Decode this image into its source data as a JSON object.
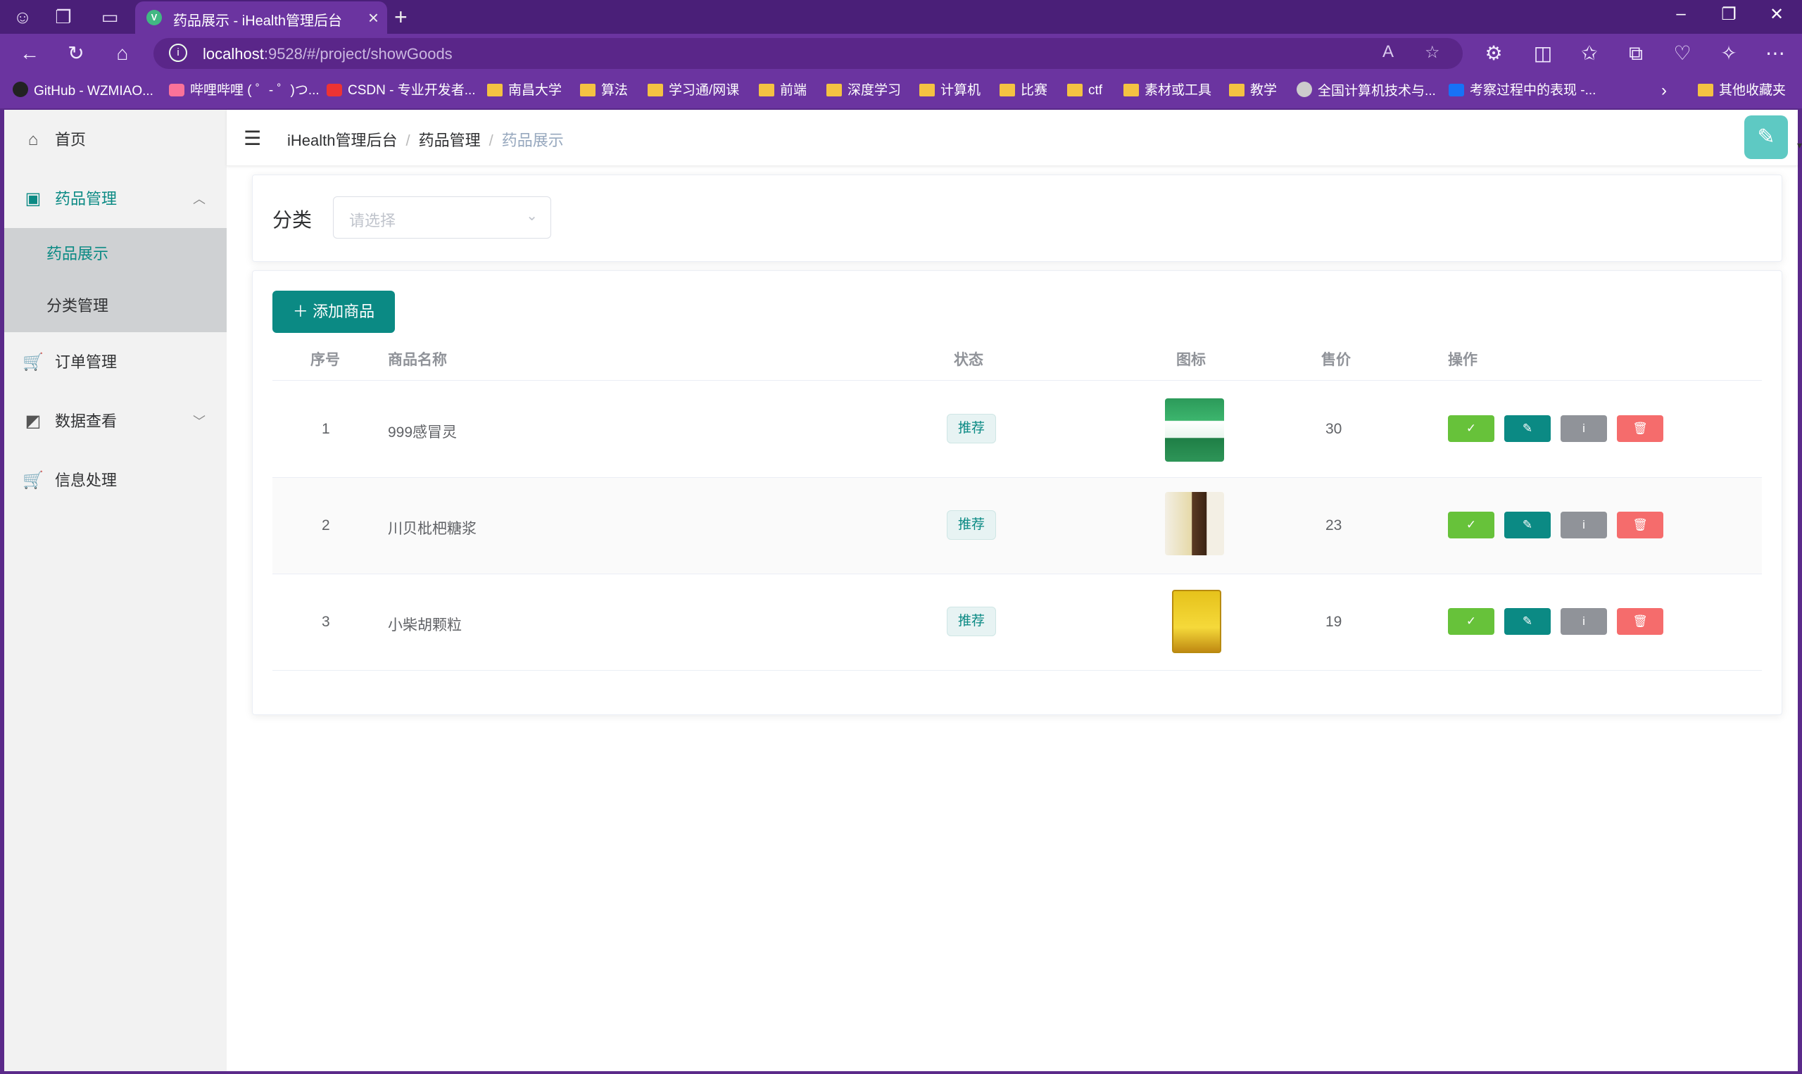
{
  "browser": {
    "tab_title": "药品展示 - iHealth管理后台",
    "url_host": "localhost",
    "url_rest": ":9528/#/project/showGoods",
    "bookmarks": [
      "GitHub - WZMIAO...",
      "哔哩哔哩 ( ゜- ゜)つ...",
      "CSDN - 专业开发者...",
      "南昌大学",
      "算法",
      "学习通/网课",
      "前端",
      "深度学习",
      "计算机",
      "比赛",
      "ctf",
      "素材或工具",
      "教学",
      "全国计算机技术与...",
      "考察过程中的表现 -...",
      "其他收藏夹"
    ]
  },
  "sidebar": {
    "items": [
      {
        "label": "首页",
        "icon": "home-icon"
      },
      {
        "label": "药品管理",
        "icon": "bag-icon"
      },
      {
        "label": "订单管理",
        "icon": "cart-icon"
      },
      {
        "label": "数据查看",
        "icon": "chart-icon"
      },
      {
        "label": "信息处理",
        "icon": "cart-icon"
      }
    ],
    "subitems": [
      {
        "label": "药品展示"
      },
      {
        "label": "分类管理"
      }
    ]
  },
  "header": {
    "breadcrumb": [
      "iHealth管理后台",
      "药品管理",
      "药品展示"
    ]
  },
  "filter": {
    "label": "分类",
    "placeholder": "请选择"
  },
  "toolbar": {
    "add_label": "添加商品"
  },
  "table": {
    "headers": [
      "序号",
      "商品名称",
      "状态",
      "图标",
      "售价",
      "操作"
    ],
    "rows": [
      {
        "index": "1",
        "name": "999感冒灵",
        "status": "推荐",
        "price": "30"
      },
      {
        "index": "2",
        "name": "川贝枇杷糖浆",
        "status": "推荐",
        "price": "23"
      },
      {
        "index": "3",
        "name": "小柴胡颗粒",
        "status": "推荐",
        "price": "19"
      }
    ],
    "actions": {
      "check": "✓",
      "edit": "✎",
      "info": "i",
      "delete": "🗑"
    }
  },
  "colors": {
    "accent": "#0b8a84",
    "success": "#67c23a",
    "info": "#909399",
    "danger": "#f56c6c",
    "browser": "#6b34a0"
  }
}
